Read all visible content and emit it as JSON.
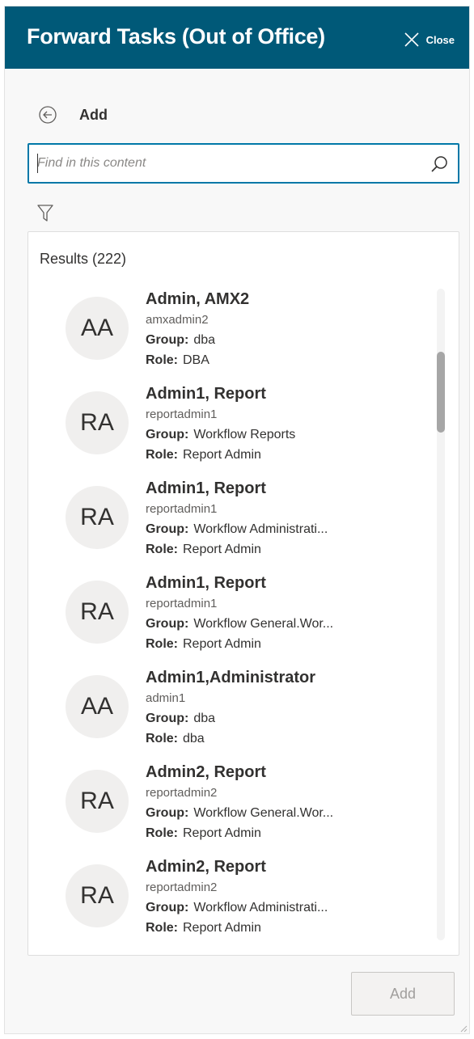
{
  "header": {
    "title": "Forward Tasks (Out of Office)",
    "close_label": "Close"
  },
  "toolbar": {
    "back_icon": "back-circle-arrow-icon",
    "heading": "Add"
  },
  "search": {
    "placeholder": "Find in this content",
    "value": "",
    "icon": "search-icon"
  },
  "filter": {
    "icon": "filter-icon"
  },
  "results": {
    "count_label": "Results (222)",
    "group_label": "Group:",
    "role_label": "Role:",
    "items": [
      {
        "initials": "AA",
        "name": "Admin, AMX2",
        "username": "amxadmin2",
        "group": "dba",
        "role": "DBA"
      },
      {
        "initials": "RA",
        "name": "Admin1, Report",
        "username": "reportadmin1",
        "group": "Workflow Reports",
        "role": "Report Admin"
      },
      {
        "initials": "RA",
        "name": "Admin1, Report",
        "username": "reportadmin1",
        "group": "Workflow Administrati...",
        "role": "Report Admin"
      },
      {
        "initials": "RA",
        "name": "Admin1, Report",
        "username": "reportadmin1",
        "group": "Workflow General.Wor...",
        "role": "Report Admin"
      },
      {
        "initials": "AA",
        "name": "Admin1,Administrator",
        "username": "admin1",
        "group": "dba",
        "role": "dba"
      },
      {
        "initials": "RA",
        "name": "Admin2, Report",
        "username": "reportadmin2",
        "group": "Workflow General.Wor...",
        "role": "Report Admin"
      },
      {
        "initials": "RA",
        "name": "Admin2, Report",
        "username": "reportadmin2",
        "group": "Workflow Administrati...",
        "role": "Report Admin"
      }
    ]
  },
  "footer": {
    "add_label": "Add",
    "add_disabled": true
  },
  "colors": {
    "header_bg": "#005978",
    "accent": "#0078a8",
    "panel_bg": "#f8f8f8",
    "avatar_bg": "#f0efee"
  }
}
